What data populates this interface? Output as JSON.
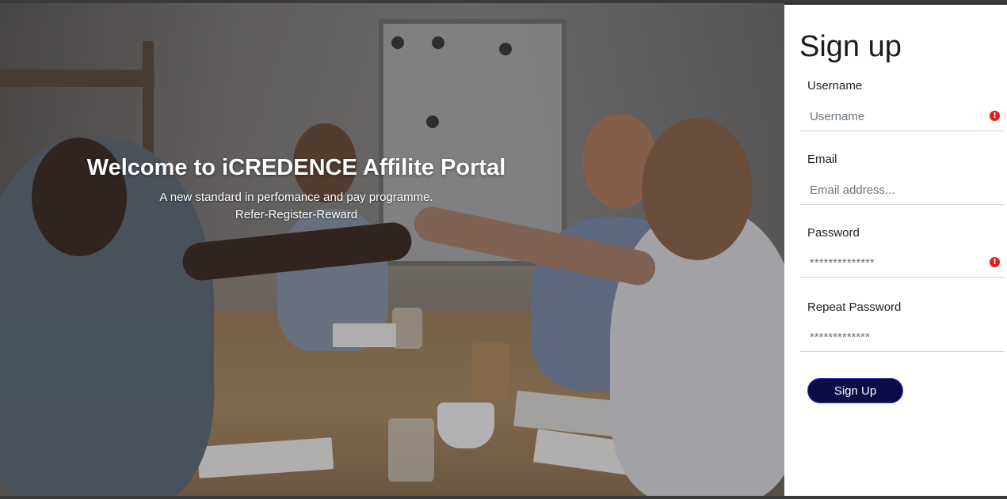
{
  "hero": {
    "title": "Welcome to iCREDENCE Affilite Portal",
    "subtitle": "A new standard in perfomance and pay programme.",
    "tagline": "Refer-Register-Reward"
  },
  "signup": {
    "heading": "Sign up",
    "username": {
      "label": "Username",
      "placeholder": "Username",
      "value": ""
    },
    "email": {
      "label": "Email",
      "placeholder": "Email address...",
      "value": ""
    },
    "password": {
      "label": "Password",
      "placeholder": "**************",
      "value": ""
    },
    "repeat_password": {
      "label": "Repeat Password",
      "placeholder": "*************",
      "value": ""
    },
    "submit_label": "Sign Up",
    "warning_glyph": "!"
  },
  "colors": {
    "button_bg": "#0c0c46",
    "warning": "#e01f1f"
  }
}
